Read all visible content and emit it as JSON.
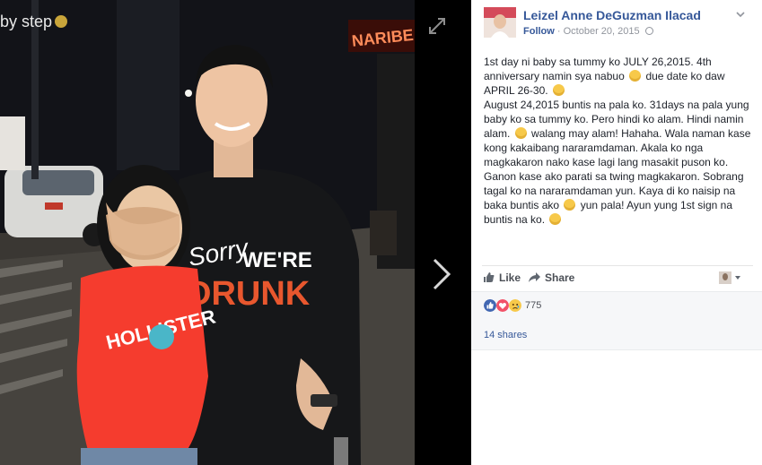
{
  "viewer": {
    "caption_peek": "by step",
    "photo_sign": "NARIBE",
    "shirt_text_1": "Sorry",
    "shirt_text_2": "WE'RE",
    "shirt_text_3": "DRUNK",
    "red_shirt_text": "HOLLISTER"
  },
  "post": {
    "author": "Leizel Anne DeGuzman Ilacad",
    "follow": "Follow",
    "date": "October 20, 2015",
    "separator": "·",
    "paragraph_1": {
      "a": "1st day ni baby sa tummy ko JULY 26,2015. 4th anniversary namin sya nabuo",
      "b": "due date ko daw APRIL 26-30."
    },
    "paragraph_2": {
      "a": "August 24,2015 buntis na pala ko. 31days na pala yung baby ko sa tummy ko. Pero hindi ko alam. Hindi namin alam.",
      "b": "walang may alam! Hahaha. Wala naman kase kong kakaibang nararamdaman. Akala ko nga magkakaron nako kase lagi lang masakit puson ko. Ganon kase ako parati sa twing magkakaron. Sobrang tagal ko na nararamdaman yun. Kaya di ko naisip na baka buntis ako",
      "c": "yun pala! Ayun yung 1st sign na buntis na ko."
    }
  },
  "actions": {
    "like": "Like",
    "share": "Share"
  },
  "reactions": {
    "count": "775"
  },
  "shares": {
    "label": "14 shares"
  },
  "colors": {
    "link": "#365899",
    "like_blue": "#4267b2",
    "love_red": "#f25268"
  }
}
